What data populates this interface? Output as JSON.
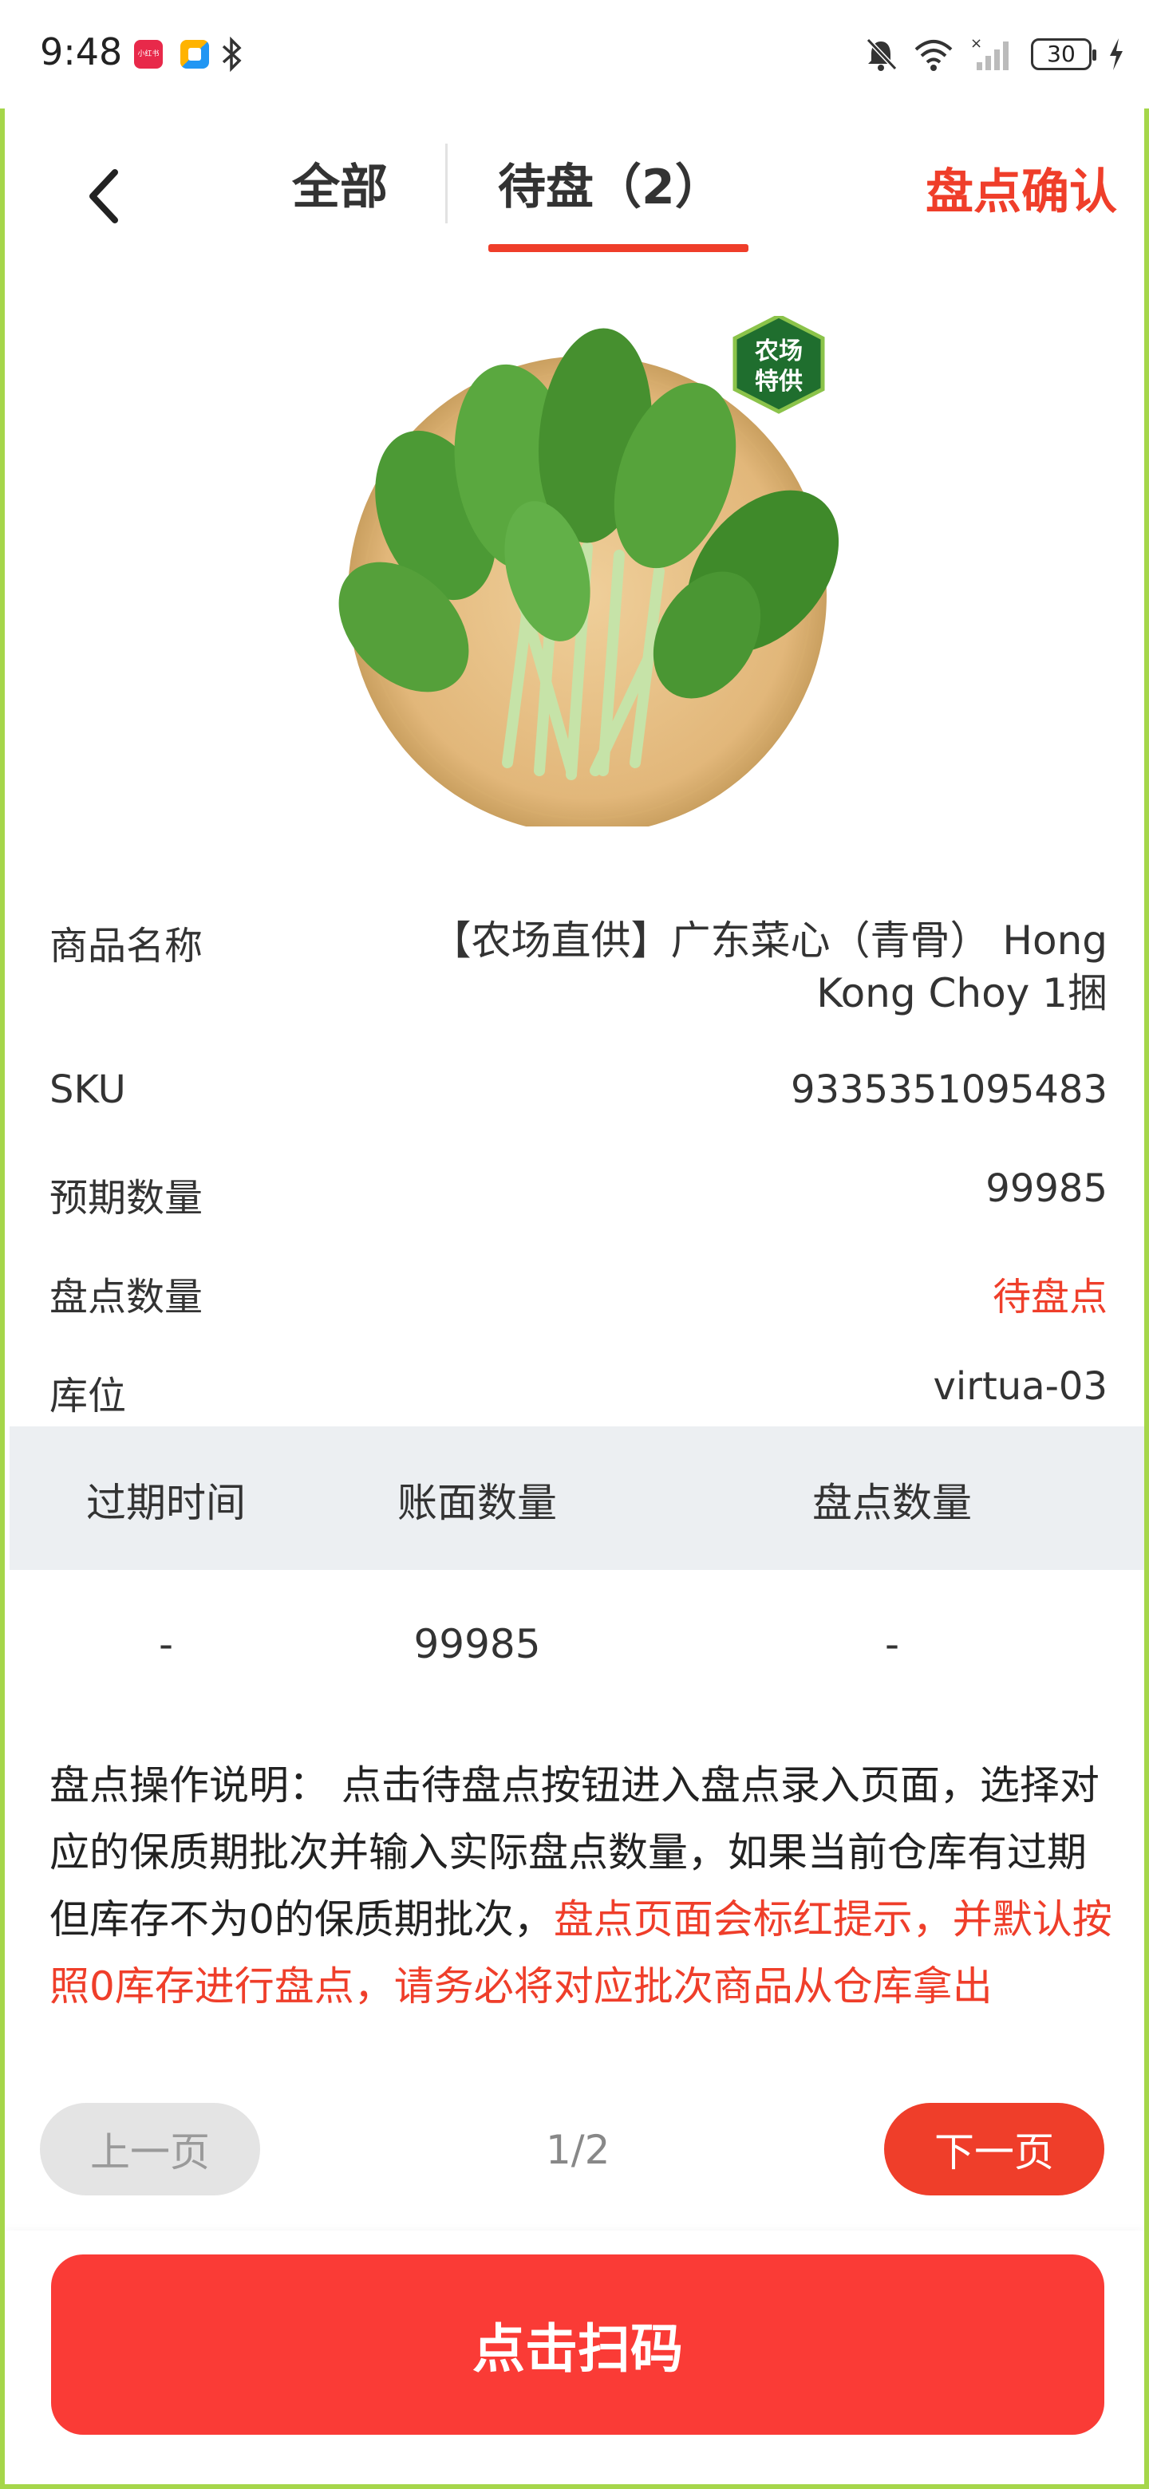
{
  "status_bar": {
    "time": "9:48",
    "app_icon_label": "小红书",
    "battery": "30",
    "icons": [
      "bluetooth-icon",
      "mute-icon",
      "wifi-icon",
      "signal-icon",
      "charging-icon"
    ]
  },
  "nav": {
    "tab_all": "全部",
    "tab_pending": "待盘（2）",
    "confirm": "盘点确认"
  },
  "product": {
    "badge_line1": "农场",
    "badge_line2": "特供",
    "name_label": "商品名称",
    "name_value": "【农场直供】广东菜心（青骨） Hong Kong Choy 1捆",
    "sku_label": "SKU",
    "sku_value": "9335351095483",
    "expected_label": "预期数量",
    "expected_value": "99985",
    "count_label": "盘点数量",
    "count_value": "待盘点",
    "location_label": "库位",
    "location_value": "virtua-03"
  },
  "batch_table": {
    "headers": [
      "过期时间",
      "账面数量",
      "盘点数量"
    ],
    "rows": [
      [
        "-",
        "99985",
        "-"
      ]
    ]
  },
  "instructions": {
    "normal": "盘点操作说明： 点击待盘点按钮进入盘点录入页面，选择对应的保质期批次并输入实际盘点数量，如果当前仓库有过期但库存不为0的保质期批次，",
    "highlight": "盘点页面会标红提示，并默认按照0库存进行盘点，请务必将对应批次商品从仓库拿出"
  },
  "pager": {
    "prev": "上一页",
    "indicator": "1/2",
    "next": "下一页"
  },
  "scan_button": "点击扫码",
  "colors": {
    "accent": "#ef3e2a",
    "scan_button": "#fa3b36",
    "frame_border": "#a5d64a",
    "table_header_bg": "#eceff2"
  }
}
